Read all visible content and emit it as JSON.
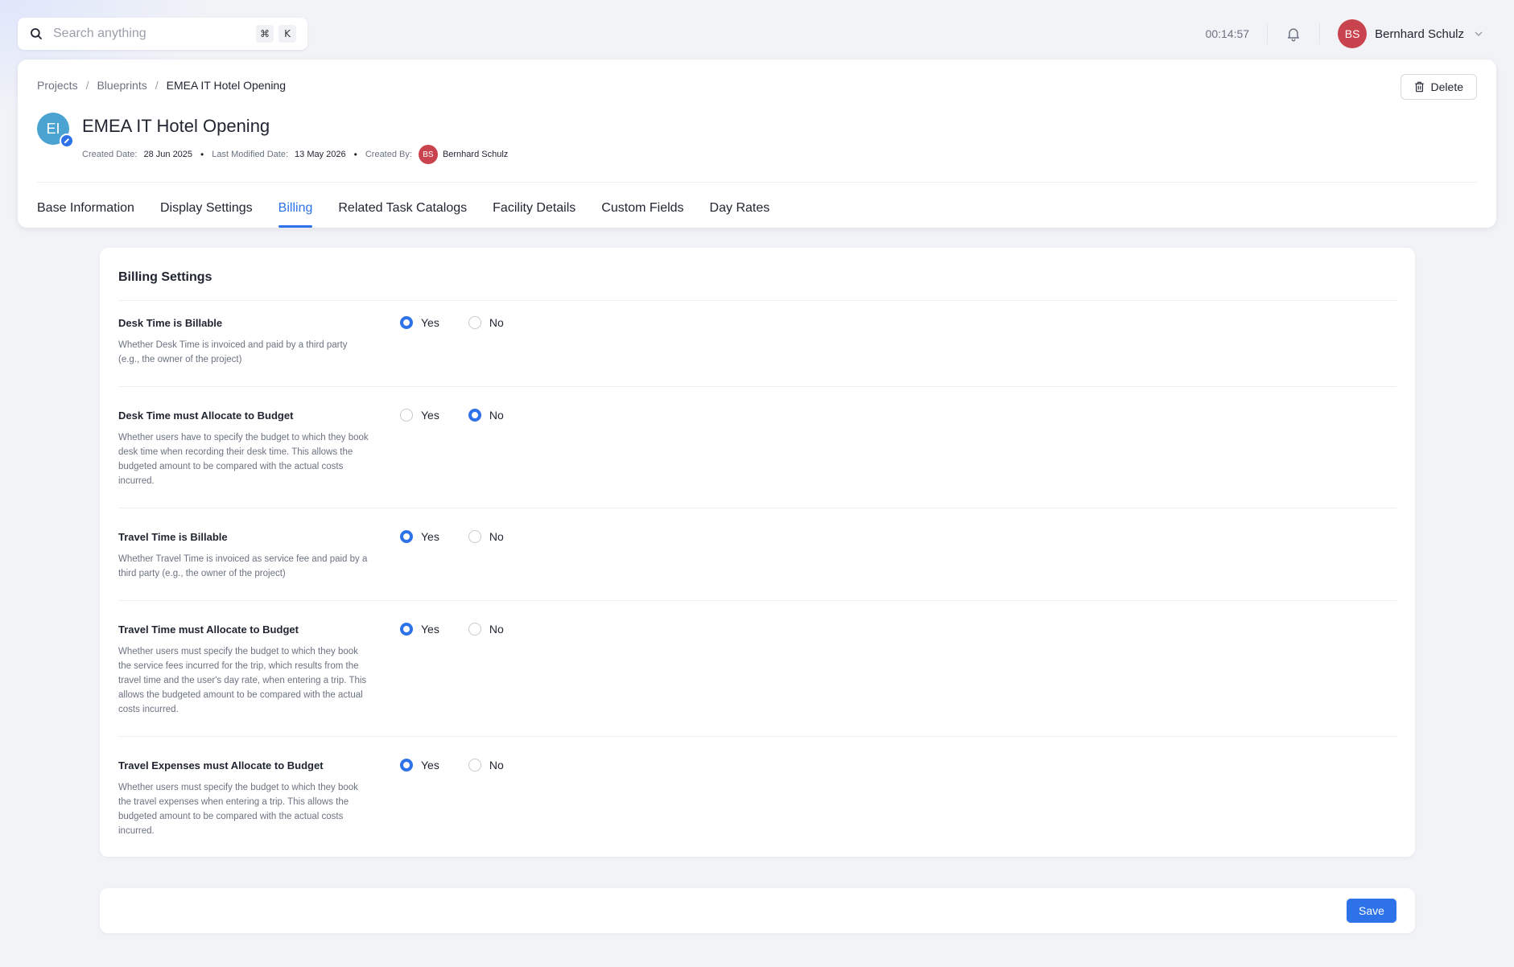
{
  "search": {
    "placeholder": "Search anything",
    "shortcut_mod": "⌘",
    "shortcut_key": "K"
  },
  "topbar": {
    "timer": "00:14:57",
    "user": {
      "initials": "BS",
      "name": "Bernhard Schulz"
    }
  },
  "breadcrumb": {
    "items": [
      "Projects",
      "Blueprints"
    ],
    "current": "EMEA IT Hotel Opening",
    "separator": "/"
  },
  "header": {
    "delete_label": "Delete",
    "project_initials": "EI",
    "title": "EMEA IT Hotel Opening",
    "meta": {
      "created_label": "Created Date:",
      "created_value": "28 Jun 2025",
      "modified_label": "Last Modified Date:",
      "modified_value": "13 May 2026",
      "created_by_label": "Created By:",
      "creator_initials": "BS",
      "creator_name": "Bernhard Schulz",
      "dot": "•"
    }
  },
  "tabs": [
    {
      "label": "Base Information",
      "active": false
    },
    {
      "label": "Display Settings",
      "active": false
    },
    {
      "label": "Billing",
      "active": true
    },
    {
      "label": "Related Task Catalogs",
      "active": false
    },
    {
      "label": "Facility Details",
      "active": false
    },
    {
      "label": "Custom Fields",
      "active": false
    },
    {
      "label": "Day Rates",
      "active": false
    }
  ],
  "billing": {
    "title": "Billing Settings",
    "yes_label": "Yes",
    "no_label": "No",
    "settings": [
      {
        "label": "Desk Time is Billable",
        "description": "Whether Desk Time is invoiced and paid by a third party (e.g., the owner of the project)",
        "value": "Yes"
      },
      {
        "label": "Desk Time must Allocate to Budget",
        "description": "Whether users have to specify the budget to which they book desk time when recording their desk time. This allows the budgeted amount to be compared with the actual costs incurred.",
        "value": "No"
      },
      {
        "label": "Travel Time is Billable",
        "description": "Whether Travel Time is invoiced as service fee and paid by a third party (e.g., the owner of the project)",
        "value": "Yes"
      },
      {
        "label": "Travel Time must Allocate to Budget",
        "description": "Whether users must specify the budget to which they book the service fees incurred for the trip, which results from the travel time and the user's day rate, when entering a trip. This allows the budgeted amount to be compared with the actual costs incurred.",
        "value": "Yes"
      },
      {
        "label": "Travel Expenses must Allocate to Budget",
        "description": "Whether users must specify the budget to which they book the travel expenses when entering a trip. This allows the budgeted amount to be compared with the actual costs incurred.",
        "value": "Yes"
      }
    ]
  },
  "footer": {
    "save_label": "Save"
  },
  "colors": {
    "accent": "#2d72e8",
    "user_avatar": "#c9434f",
    "project_avatar": "#4aa3d1"
  }
}
